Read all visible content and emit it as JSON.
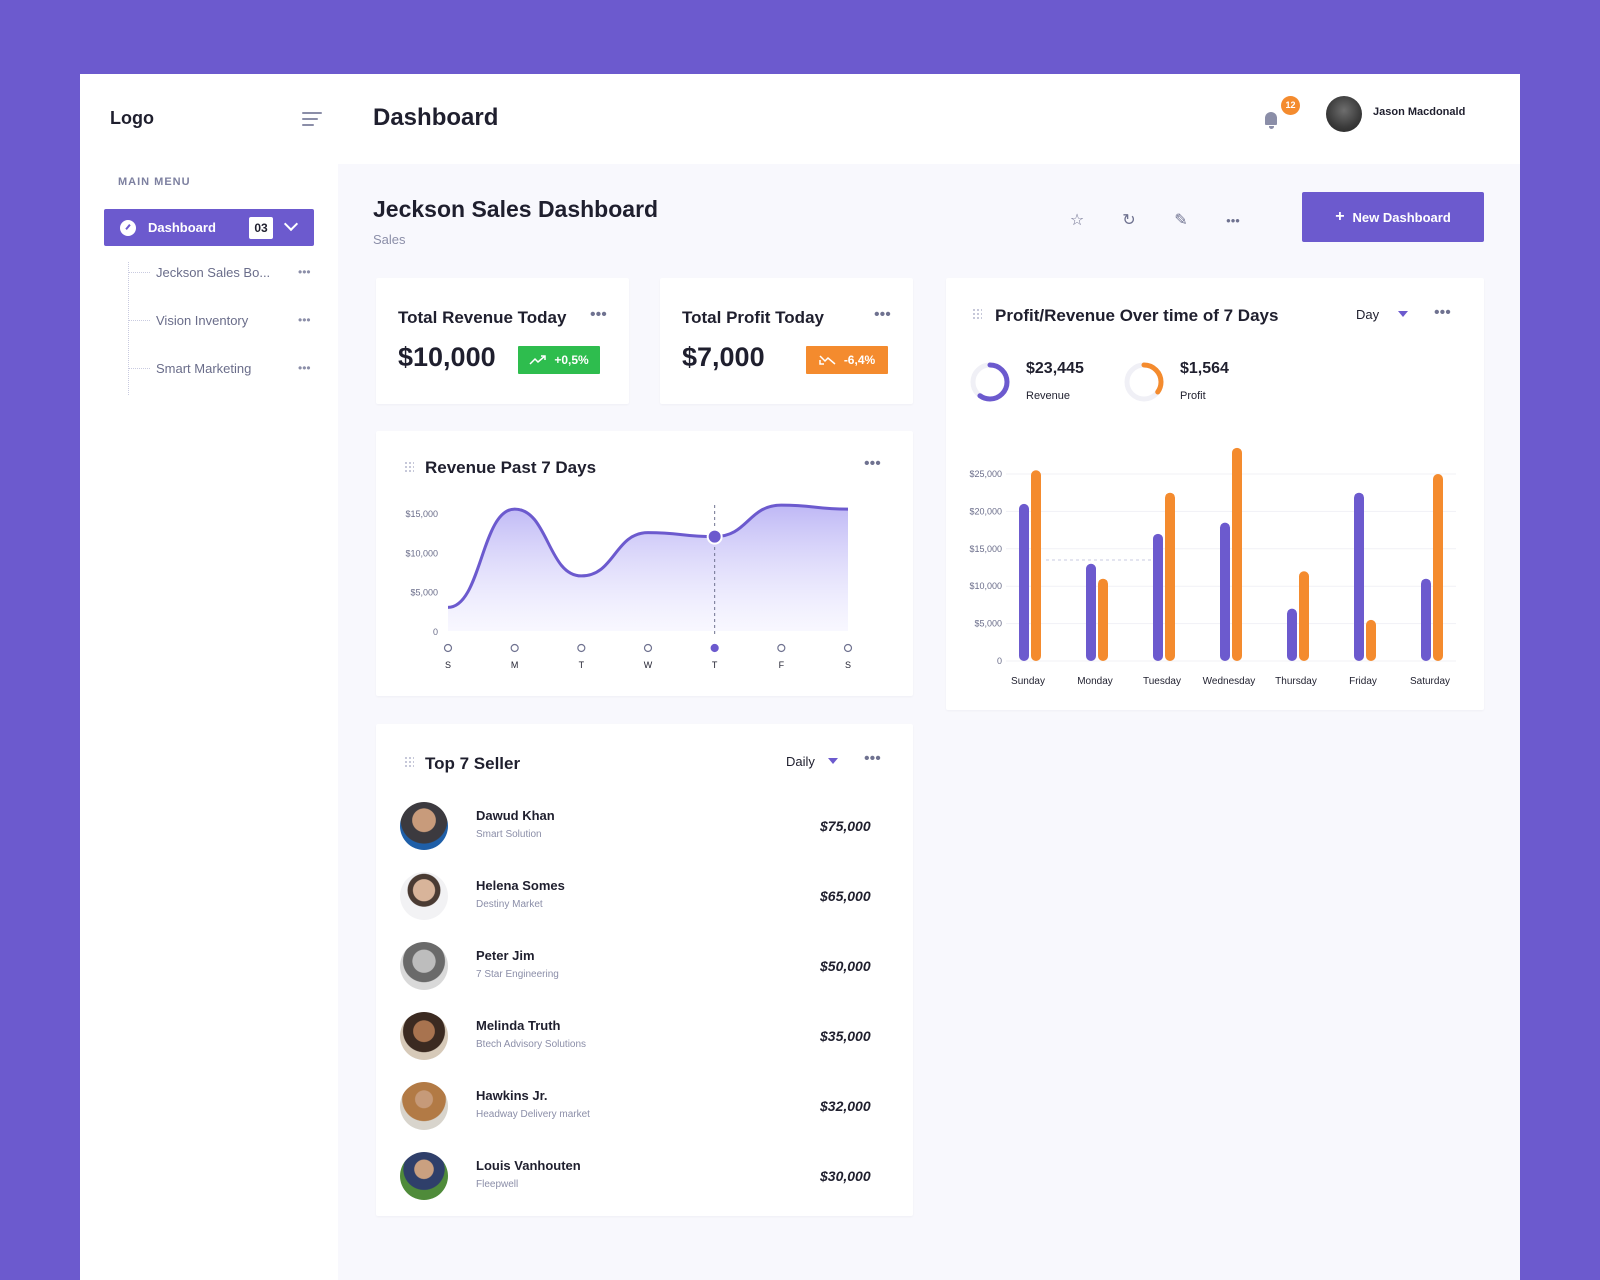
{
  "sidebar": {
    "logo": "Logo",
    "menu_title": "MAIN MENU",
    "active": {
      "label": "Dashboard",
      "badge": "03"
    },
    "items": [
      {
        "label": "Jeckson Sales Bo..."
      },
      {
        "label": "Vision Inventory"
      },
      {
        "label": "Smart Marketing"
      }
    ]
  },
  "header": {
    "title": "Dashboard",
    "notifications": "12",
    "user_name": "Jason Macdonald"
  },
  "section": {
    "title": "Jeckson Sales Dashboard",
    "subtitle": "Sales",
    "new_button": "New Dashboard"
  },
  "kpis": [
    {
      "title": "Total Revenue Today",
      "value": "$10,000",
      "change": "+0,5%",
      "color": "#2ebd4e"
    },
    {
      "title": "Total Profit Today",
      "value": "$7,000",
      "change": "-6,4%",
      "color": "#f48b2e"
    }
  ],
  "revenue_chart": {
    "title": "Revenue Past 7 Days",
    "y_ticks": [
      "$15,000",
      "$10,000",
      "$5,000",
      "0"
    ],
    "x_ticks": [
      "S",
      "M",
      "T",
      "W",
      "T",
      "F",
      "S"
    ]
  },
  "profit_chart": {
    "title": "Profit/Revenue Over time of 7 Days",
    "period": "Day",
    "revenue_total": "$23,445",
    "revenue_label": "Revenue",
    "profit_total": "$1,564",
    "profit_label": "Profit",
    "y_ticks": [
      "$25,000",
      "$20,000",
      "$15,000",
      "$10,000",
      "$5,000",
      "0"
    ]
  },
  "sellers": {
    "title": "Top 7 Seller",
    "period": "Daily",
    "rows": [
      {
        "name": "Dawud Khan",
        "company": "Smart Solution",
        "amount": "$75,000"
      },
      {
        "name": "Helena Somes",
        "company": "Destiny Market",
        "amount": "$65,000"
      },
      {
        "name": "Peter Jim",
        "company": "7 Star Engineering",
        "amount": "$50,000"
      },
      {
        "name": "Melinda Truth",
        "company": "Btech Advisory Solutions",
        "amount": "$35,000"
      },
      {
        "name": "Hawkins Jr.",
        "company": "Headway Delivery market",
        "amount": "$32,000"
      },
      {
        "name": "Louis Vanhouten",
        "company": "Fleepwell",
        "amount": "$30,000"
      }
    ]
  },
  "colors": {
    "accent": "#6c5ace",
    "orange": "#f48b2e",
    "green": "#2ebd4e"
  },
  "chart_data": [
    {
      "type": "area",
      "title": "Revenue Past 7 Days",
      "categories": [
        "S",
        "M",
        "T",
        "W",
        "T",
        "F",
        "S"
      ],
      "values": [
        3000,
        15500,
        7000,
        12500,
        12000,
        16000,
        15500
      ],
      "ylim": [
        0,
        15000
      ],
      "highlight_index": 4
    },
    {
      "type": "bar",
      "title": "Profit/Revenue Over time of 7 Days",
      "categories": [
        "Sunday",
        "Monday",
        "Tuesday",
        "Wednesday",
        "Thursday",
        "Friday",
        "Saturday"
      ],
      "series": [
        {
          "name": "Revenue",
          "color": "#6c5ace",
          "values": [
            21000,
            13000,
            17000,
            18500,
            7000,
            22500,
            11000
          ]
        },
        {
          "name": "Profit",
          "color": "#f48b2e",
          "values": [
            25500,
            11000,
            22500,
            28500,
            12000,
            5500,
            25000
          ]
        }
      ],
      "ylim": [
        0,
        25000
      ],
      "donuts": [
        {
          "name": "Revenue",
          "fraction": 0.6
        },
        {
          "name": "Profit",
          "fraction": 0.35
        }
      ]
    }
  ]
}
